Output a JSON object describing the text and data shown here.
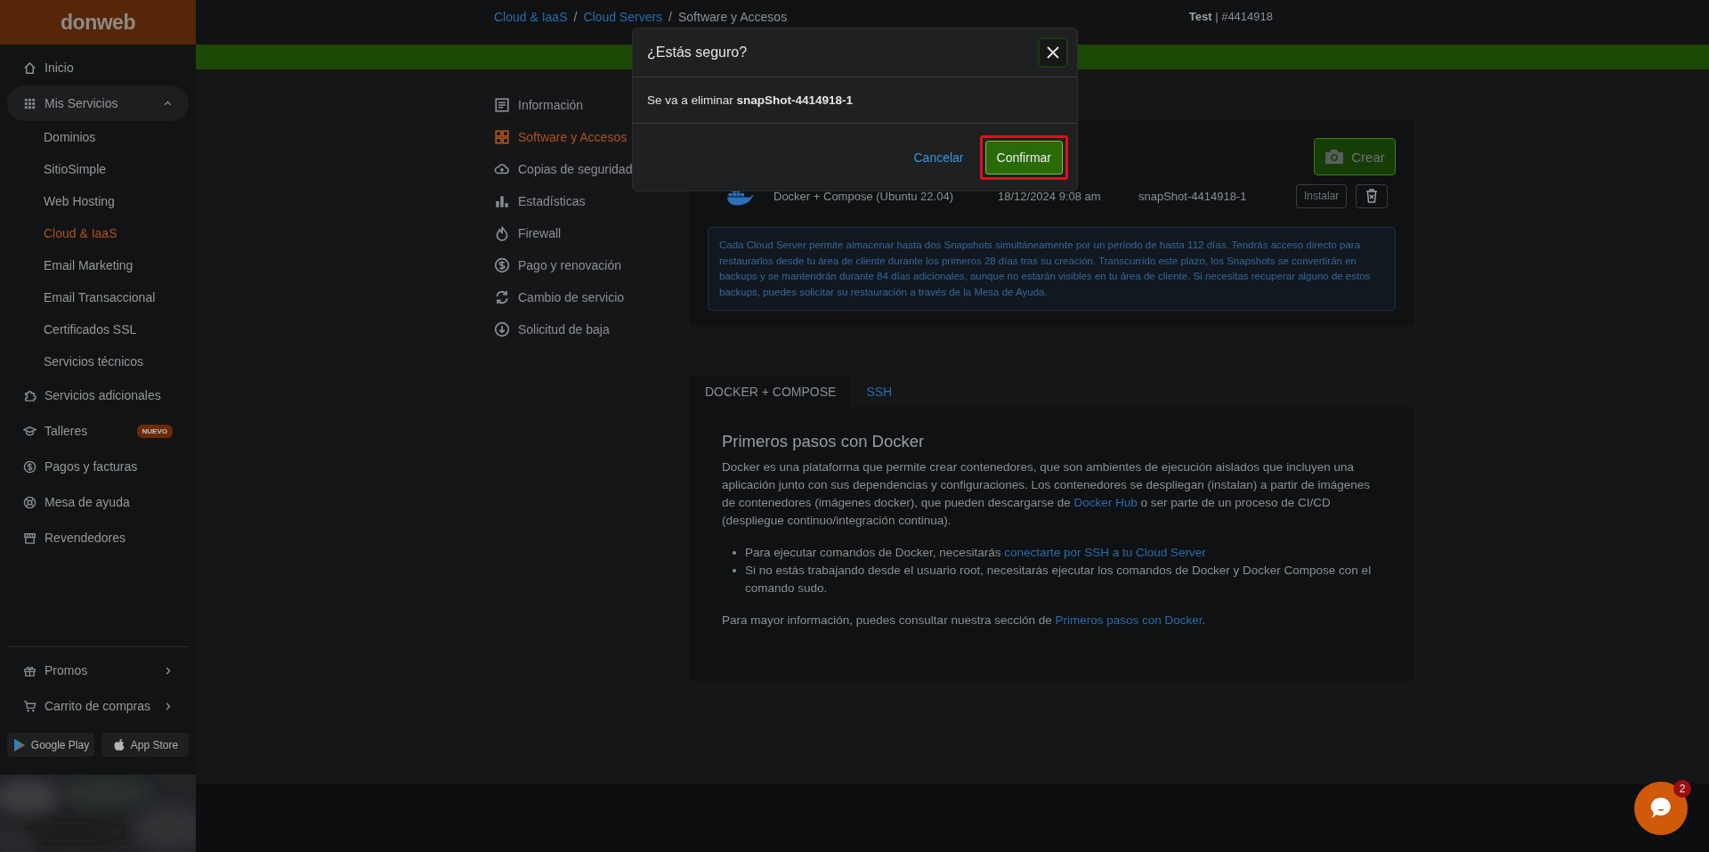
{
  "sidebar": {
    "logo": "donweb",
    "items": [
      {
        "label": "Inicio"
      },
      {
        "label": "Mis Servicios",
        "expanded": true,
        "children": [
          {
            "label": "Dominios",
            "selected": false
          },
          {
            "label": "SitioSimple",
            "selected": false
          },
          {
            "label": "Web Hosting",
            "selected": false
          },
          {
            "label": "Cloud & IaaS",
            "selected": true
          },
          {
            "label": "Email Marketing",
            "selected": false
          },
          {
            "label": "Email Transaccional",
            "selected": false
          },
          {
            "label": "Certificados SSL",
            "selected": false
          },
          {
            "label": "Servicios técnicos",
            "selected": false
          }
        ]
      },
      {
        "label": "Servicios adicionales"
      },
      {
        "label": "Talleres",
        "badge": "NUEVO"
      },
      {
        "label": "Pagos y facturas"
      },
      {
        "label": "Mesa de ayuda"
      },
      {
        "label": "Revendedores"
      }
    ],
    "bottom_items": [
      {
        "label": "Promos"
      },
      {
        "label": "Carrito de compras"
      }
    ],
    "stores": [
      {
        "label": "Google Play"
      },
      {
        "label": "App Store"
      }
    ]
  },
  "breadcrumb": {
    "separator": "/",
    "items": [
      {
        "label": "Cloud & IaaS",
        "link": true
      },
      {
        "label": "Cloud Servers",
        "link": true
      },
      {
        "label": "Software y Accesos",
        "link": false
      }
    ]
  },
  "account": "**Test** | #4414918",
  "menu": [
    {
      "label": "Información",
      "selected": false
    },
    {
      "label": "Software y Accesos",
      "selected": true
    },
    {
      "label": "Copias de seguridad",
      "selected": false
    },
    {
      "label": "Estadísticas",
      "selected": false
    },
    {
      "label": "Firewall",
      "selected": false
    },
    {
      "label": "Pago y renovación",
      "selected": false
    },
    {
      "label": "Cambio de servicio",
      "selected": false
    },
    {
      "label": "Solicitud de baja",
      "selected": false
    }
  ],
  "snapshots": {
    "create_button": "Crear",
    "rows": [
      {
        "software": "Docker + Compose (Ubuntu 22.04)",
        "date": "18/12/2024 9:08 am",
        "name": "snapShot-4414918-1",
        "install_button": "Instalar"
      }
    ],
    "info": "Cada Cloud Server permite almacenar hasta dos Snapshots simultáneamente por un período de hasta 112 días. Tendrás acceso directo para restaurarlos desde tu área de cliente durante los primeros 28 días tras su creación. Transcurrido este plazo, los Snapshots se convertirán en backups y se mantendrán durante 84 días adicionales, aunque no estarán visibles en tu área de cliente. Si necesitas recuperar alguno de estos backups, puedes solicitar su restauración a través de la Mesa de Ayuda."
  },
  "tabs": [
    {
      "label": "DOCKER + COMPOSE",
      "selected": true
    },
    {
      "label": "SSH",
      "selected": false
    }
  ],
  "panel": {
    "heading": "Primeros pasos con Docker",
    "intro": [
      {
        "text": "Docker es una plataforma que permite crear contenedores, que son ambientes de ejecución aislados que incluyen una aplicación junto con sus dependencias y configuraciones. Los contenedores se despliegan (instalan) a partir de imágenes de contenedores (imágenes docker), que pueden descargarse de "
      },
      {
        "text": "Docker Hub",
        "link": true
      },
      {
        "text": " o ser parte de un proceso de CI/CD (despliegue continuo/integración continua)."
      }
    ],
    "bullets": [
      [
        {
          "text": "Para ejecutar comandos de Docker, necesitarás "
        },
        {
          "text": "conectarte por SSH a tu Cloud Server",
          "link": true
        }
      ],
      [
        {
          "text": "Si no estás trabajando desde el usuario root, necesitarás ejecutar los comandos de Docker y Docker Compose con el comando sudo."
        }
      ]
    ],
    "footer": [
      {
        "text": "Para mayor información, puedes consultar nuestra sección de "
      },
      {
        "text": "Primeros pasos con Docker",
        "link": true
      },
      {
        "text": "."
      }
    ]
  },
  "dialog": {
    "title": "¿Estás seguro?",
    "message": [
      {
        "text": "Se va a eliminar "
      },
      {
        "text": "snapShot-4414918-1",
        "bold": true
      }
    ],
    "cancel": "Cancelar",
    "confirm": "Confirmar",
    "confirm_highlighted": true
  },
  "chat": {
    "badge": "2"
  }
}
